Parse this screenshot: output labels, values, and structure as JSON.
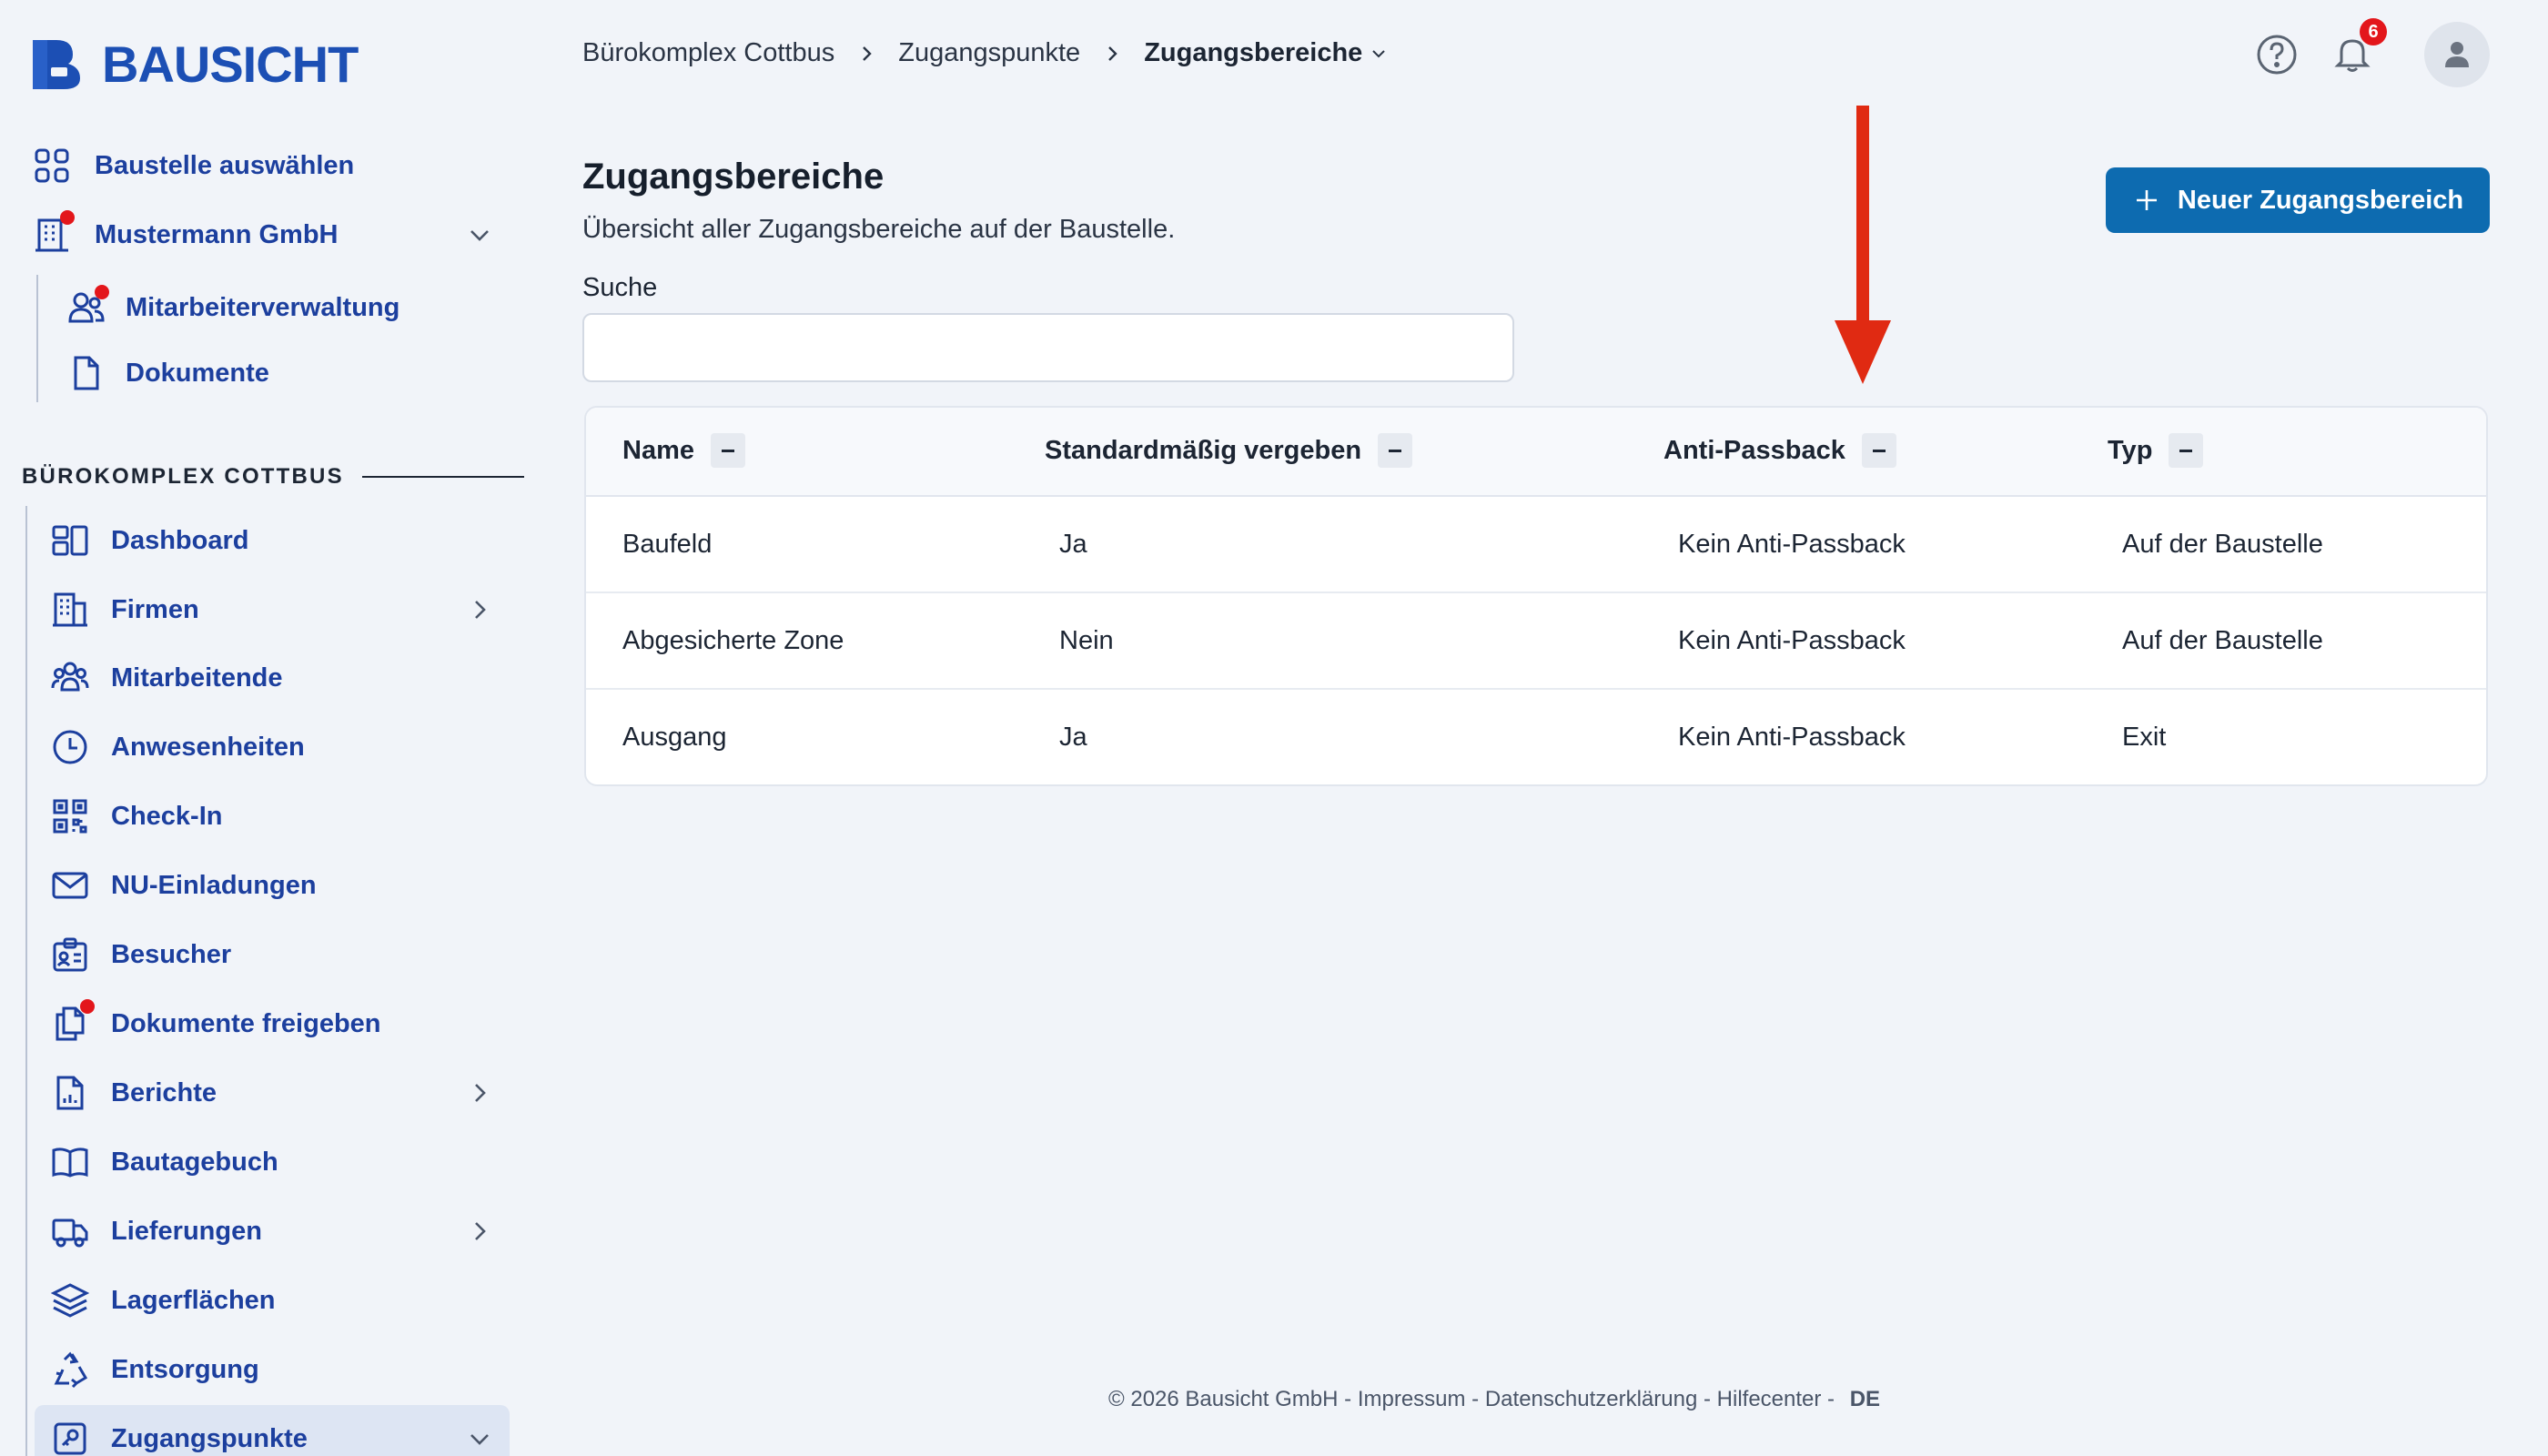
{
  "app": {
    "name": "BAUSICHT"
  },
  "sidebar": {
    "select_site": "Baustelle auswählen",
    "company": "Mustermann GmbH",
    "company_items": [
      {
        "label": "Mitarbeiterverwaltung"
      },
      {
        "label": "Dokumente"
      }
    ],
    "section_title": "BÜROKOMPLEX COTTBUS",
    "items": [
      {
        "label": "Dashboard"
      },
      {
        "label": "Firmen"
      },
      {
        "label": "Mitarbeitende"
      },
      {
        "label": "Anwesenheiten"
      },
      {
        "label": "Check-In"
      },
      {
        "label": "NU-Einladungen"
      },
      {
        "label": "Besucher"
      },
      {
        "label": "Dokumente freigeben"
      },
      {
        "label": "Berichte"
      },
      {
        "label": "Bautagebuch"
      },
      {
        "label": "Lieferungen"
      },
      {
        "label": "Lagerflächen"
      },
      {
        "label": "Entsorgung"
      },
      {
        "label": "Zugangspunkte"
      }
    ],
    "active_item": "Zugangspunkte"
  },
  "header": {
    "breadcrumb": [
      "Bürokomplex Cottbus",
      "Zugangspunkte",
      "Zugangsbereiche"
    ],
    "notification_count": "6"
  },
  "main": {
    "title": "Zugangsbereiche",
    "subtitle": "Übersicht aller Zugangsbereiche auf der Baustelle.",
    "new_button": "Neuer Zugangsbereich",
    "search_label": "Suche",
    "search_value": "",
    "table": {
      "columns": [
        "Name",
        "Standardmäßig vergeben",
        "Anti-Passback",
        "Typ"
      ],
      "rows": [
        [
          "Baufeld",
          "Ja",
          "Kein Anti-Passback",
          "Auf der Baustelle"
        ],
        [
          "Abgesicherte Zone",
          "Nein",
          "Kein Anti-Passback",
          "Auf der Baustelle"
        ],
        [
          "Ausgang",
          "Ja",
          "Kein Anti-Passback",
          "Exit"
        ]
      ]
    }
  },
  "footer": {
    "copyright": "© 2026 Bausicht GmbH",
    "links": [
      "Impressum",
      "Datenschutzerklärung",
      "Hilfecenter"
    ],
    "language": "DE"
  },
  "colors": {
    "brand": "#1c4fb4",
    "primary_button": "#0d6bb0",
    "badge": "#e3161b",
    "annotation_arrow": "#e02a12"
  }
}
